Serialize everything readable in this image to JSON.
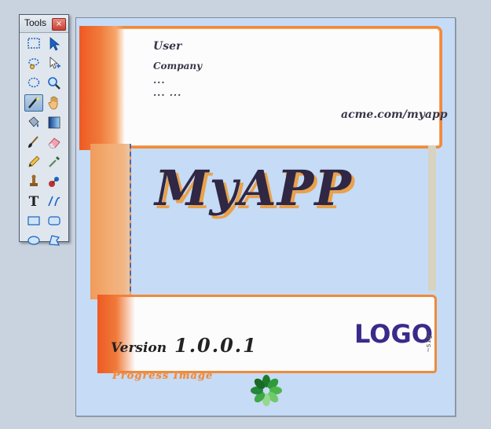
{
  "tools_window": {
    "title": "Tools",
    "close_glyph": "×",
    "tools": [
      {
        "name": "rect-select-icon",
        "active": false
      },
      {
        "name": "pointer-icon",
        "active": false
      },
      {
        "name": "lasso-select-icon",
        "active": false
      },
      {
        "name": "move-selection-icon",
        "active": false
      },
      {
        "name": "ellipse-select-icon",
        "active": false
      },
      {
        "name": "zoom-icon",
        "active": false
      },
      {
        "name": "magic-wand-icon",
        "active": true
      },
      {
        "name": "pan-hand-icon",
        "active": false
      },
      {
        "name": "paint-bucket-icon",
        "active": false
      },
      {
        "name": "gradient-icon",
        "active": false
      },
      {
        "name": "paintbrush-icon",
        "active": false
      },
      {
        "name": "eraser-icon",
        "active": false
      },
      {
        "name": "pencil-icon",
        "active": false
      },
      {
        "name": "color-picker-icon",
        "active": false
      },
      {
        "name": "clone-stamp-icon",
        "active": false
      },
      {
        "name": "recolor-icon",
        "active": false
      },
      {
        "name": "text-icon",
        "active": false
      },
      {
        "name": "line-curve-icon",
        "active": false
      },
      {
        "name": "rectangle-icon",
        "active": false
      },
      {
        "name": "rounded-rectangle-icon",
        "active": false
      },
      {
        "name": "ellipse-icon",
        "active": false
      },
      {
        "name": "freeform-shape-icon",
        "active": false
      }
    ]
  },
  "canvas": {
    "user_label": "User",
    "company_label": "Company",
    "dots_line1": "...",
    "dots_line2": "... ...",
    "url": "acme.com/myapp",
    "app_title": "MyAPP",
    "version_label": "Version",
    "version_number": "1.0.0.1",
    "logo_text": "LOGO",
    "progress_label": "Progress Image",
    "colors": {
      "background": "#c6dbf5",
      "orange_marker": "#f07a3a",
      "title_color": "#2f2744",
      "logo_color": "#3a2a8a"
    }
  }
}
